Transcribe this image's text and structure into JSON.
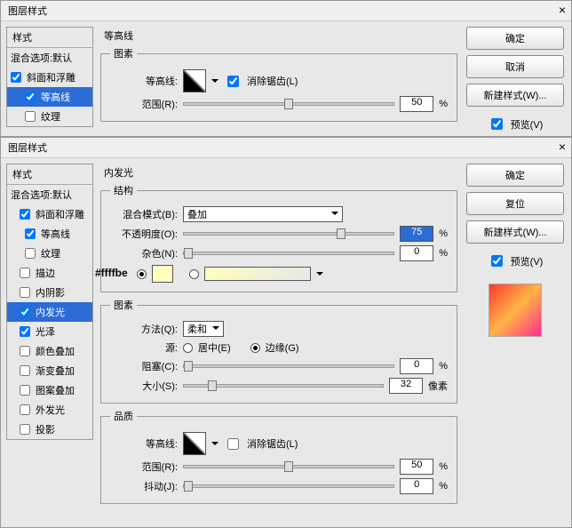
{
  "dialog1": {
    "title": "图层样式",
    "styles_header": "样式",
    "blend_defaults": "混合选项:默认",
    "rows": [
      {
        "label": "斜面和浮雕",
        "checked": true
      },
      {
        "label": "等高线",
        "checked": true,
        "selected": true
      },
      {
        "label": "纹理",
        "checked": false
      }
    ],
    "section": "等高线",
    "group_tusu": "图素",
    "contour_label": "等高线:",
    "antialias": "消除锯齿(L)",
    "range_label": "范围(R):",
    "range_value": "50",
    "percent": "%",
    "ok": "确定",
    "cancel": "取消",
    "newstyle": "新建样式(W)...",
    "preview": "预览(V)"
  },
  "dialog2": {
    "title": "图层样式",
    "styles_header": "样式",
    "blend_defaults": "混合选项:默认",
    "rows": [
      {
        "label": "斜面和浮雕",
        "checked": true
      },
      {
        "label": "等高线",
        "checked": true
      },
      {
        "label": "纹理",
        "checked": false
      },
      {
        "label": "描边",
        "checked": false
      },
      {
        "label": "内阴影",
        "checked": false
      },
      {
        "label": "内发光",
        "checked": true,
        "selected": true
      },
      {
        "label": "光泽",
        "checked": true
      },
      {
        "label": "颜色叠加",
        "checked": false
      },
      {
        "label": "渐变叠加",
        "checked": false
      },
      {
        "label": "图案叠加",
        "checked": false
      },
      {
        "label": "外发光",
        "checked": false
      },
      {
        "label": "投影",
        "checked": false
      }
    ],
    "section": "内发光",
    "group_struct": "结构",
    "blend_mode_label": "混合模式(B):",
    "blend_mode_value": "叠加",
    "opacity_label": "不透明度(O):",
    "opacity_value": "75",
    "noise_label": "杂色(N):",
    "noise_value": "0",
    "percent": "%",
    "annot_color": "#ffffbe",
    "group_tusu": "图素",
    "method_label": "方法(Q):",
    "method_value": "柔和",
    "source_label": "源:",
    "source_center": "居中(E)",
    "source_edge": "边缘(G)",
    "choke_label": "阻塞(C):",
    "choke_value": "0",
    "size_label": "大小(S):",
    "size_value": "32",
    "px": "像素",
    "group_quality": "品质",
    "contour_label": "等高线:",
    "antialias": "消除锯齿(L)",
    "range_label": "范围(R):",
    "range_value": "50",
    "jitter_label": "抖动(J):",
    "jitter_value": "0",
    "ok": "确定",
    "reset": "复位",
    "newstyle": "新建样式(W)...",
    "preview": "预览(V)"
  }
}
